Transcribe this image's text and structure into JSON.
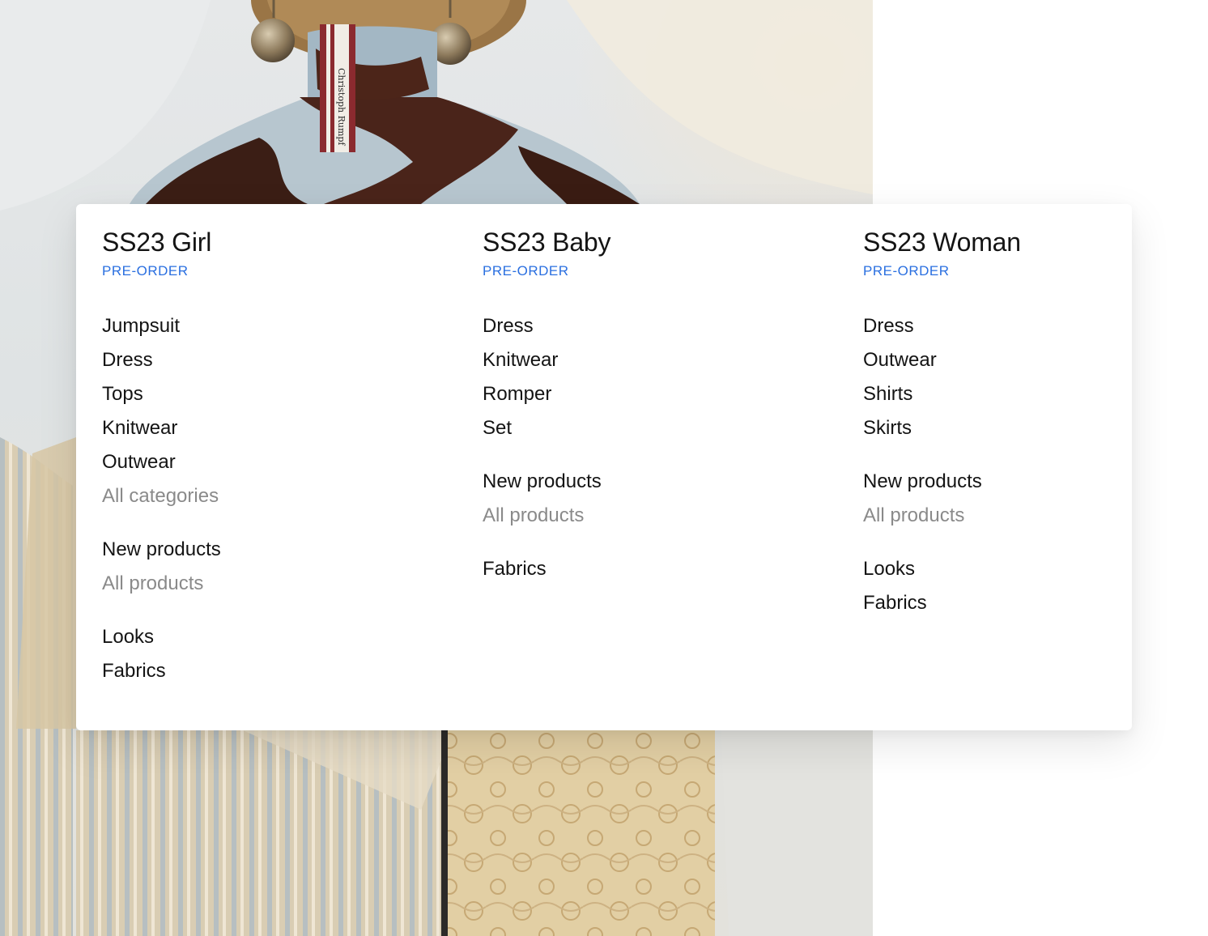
{
  "menu": {
    "columns": [
      {
        "title": "SS23 Girl",
        "tag": "PRE-ORDER",
        "groups": [
          {
            "links": [
              {
                "label": "Jumpsuit",
                "muted": false
              },
              {
                "label": "Dress",
                "muted": false
              },
              {
                "label": "Tops",
                "muted": false
              },
              {
                "label": "Knitwear",
                "muted": false
              },
              {
                "label": "Outwear",
                "muted": false
              },
              {
                "label": "All categories",
                "muted": true
              }
            ]
          },
          {
            "links": [
              {
                "label": "New products",
                "muted": false
              },
              {
                "label": "All products",
                "muted": true
              }
            ]
          },
          {
            "links": [
              {
                "label": "Looks",
                "muted": false
              },
              {
                "label": "Fabrics",
                "muted": false
              }
            ]
          }
        ]
      },
      {
        "title": "SS23 Baby",
        "tag": "PRE-ORDER",
        "groups": [
          {
            "links": [
              {
                "label": "Dress",
                "muted": false
              },
              {
                "label": "Knitwear",
                "muted": false
              },
              {
                "label": "Romper",
                "muted": false
              },
              {
                "label": "Set",
                "muted": false
              }
            ]
          },
          {
            "links": [
              {
                "label": "New products",
                "muted": false
              },
              {
                "label": "All products",
                "muted": true
              }
            ]
          },
          {
            "links": [
              {
                "label": "Fabrics",
                "muted": false
              }
            ]
          }
        ]
      },
      {
        "title": "SS23 Woman",
        "tag": "PRE-ORDER",
        "groups": [
          {
            "links": [
              {
                "label": "Dress",
                "muted": false
              },
              {
                "label": "Outwear",
                "muted": false
              },
              {
                "label": "Shirts",
                "muted": false
              },
              {
                "label": "Skirts",
                "muted": false
              }
            ]
          },
          {
            "links": [
              {
                "label": "New products",
                "muted": false
              },
              {
                "label": "All products",
                "muted": true
              }
            ]
          },
          {
            "links": [
              {
                "label": "Looks",
                "muted": false
              },
              {
                "label": "Fabrics",
                "muted": false
              }
            ]
          }
        ]
      }
    ]
  },
  "colors": {
    "accent": "#2a6fe0",
    "text": "#141414",
    "muted": "#8a8a8a"
  },
  "photo": {
    "label_text": "Christoph Rumpf"
  }
}
